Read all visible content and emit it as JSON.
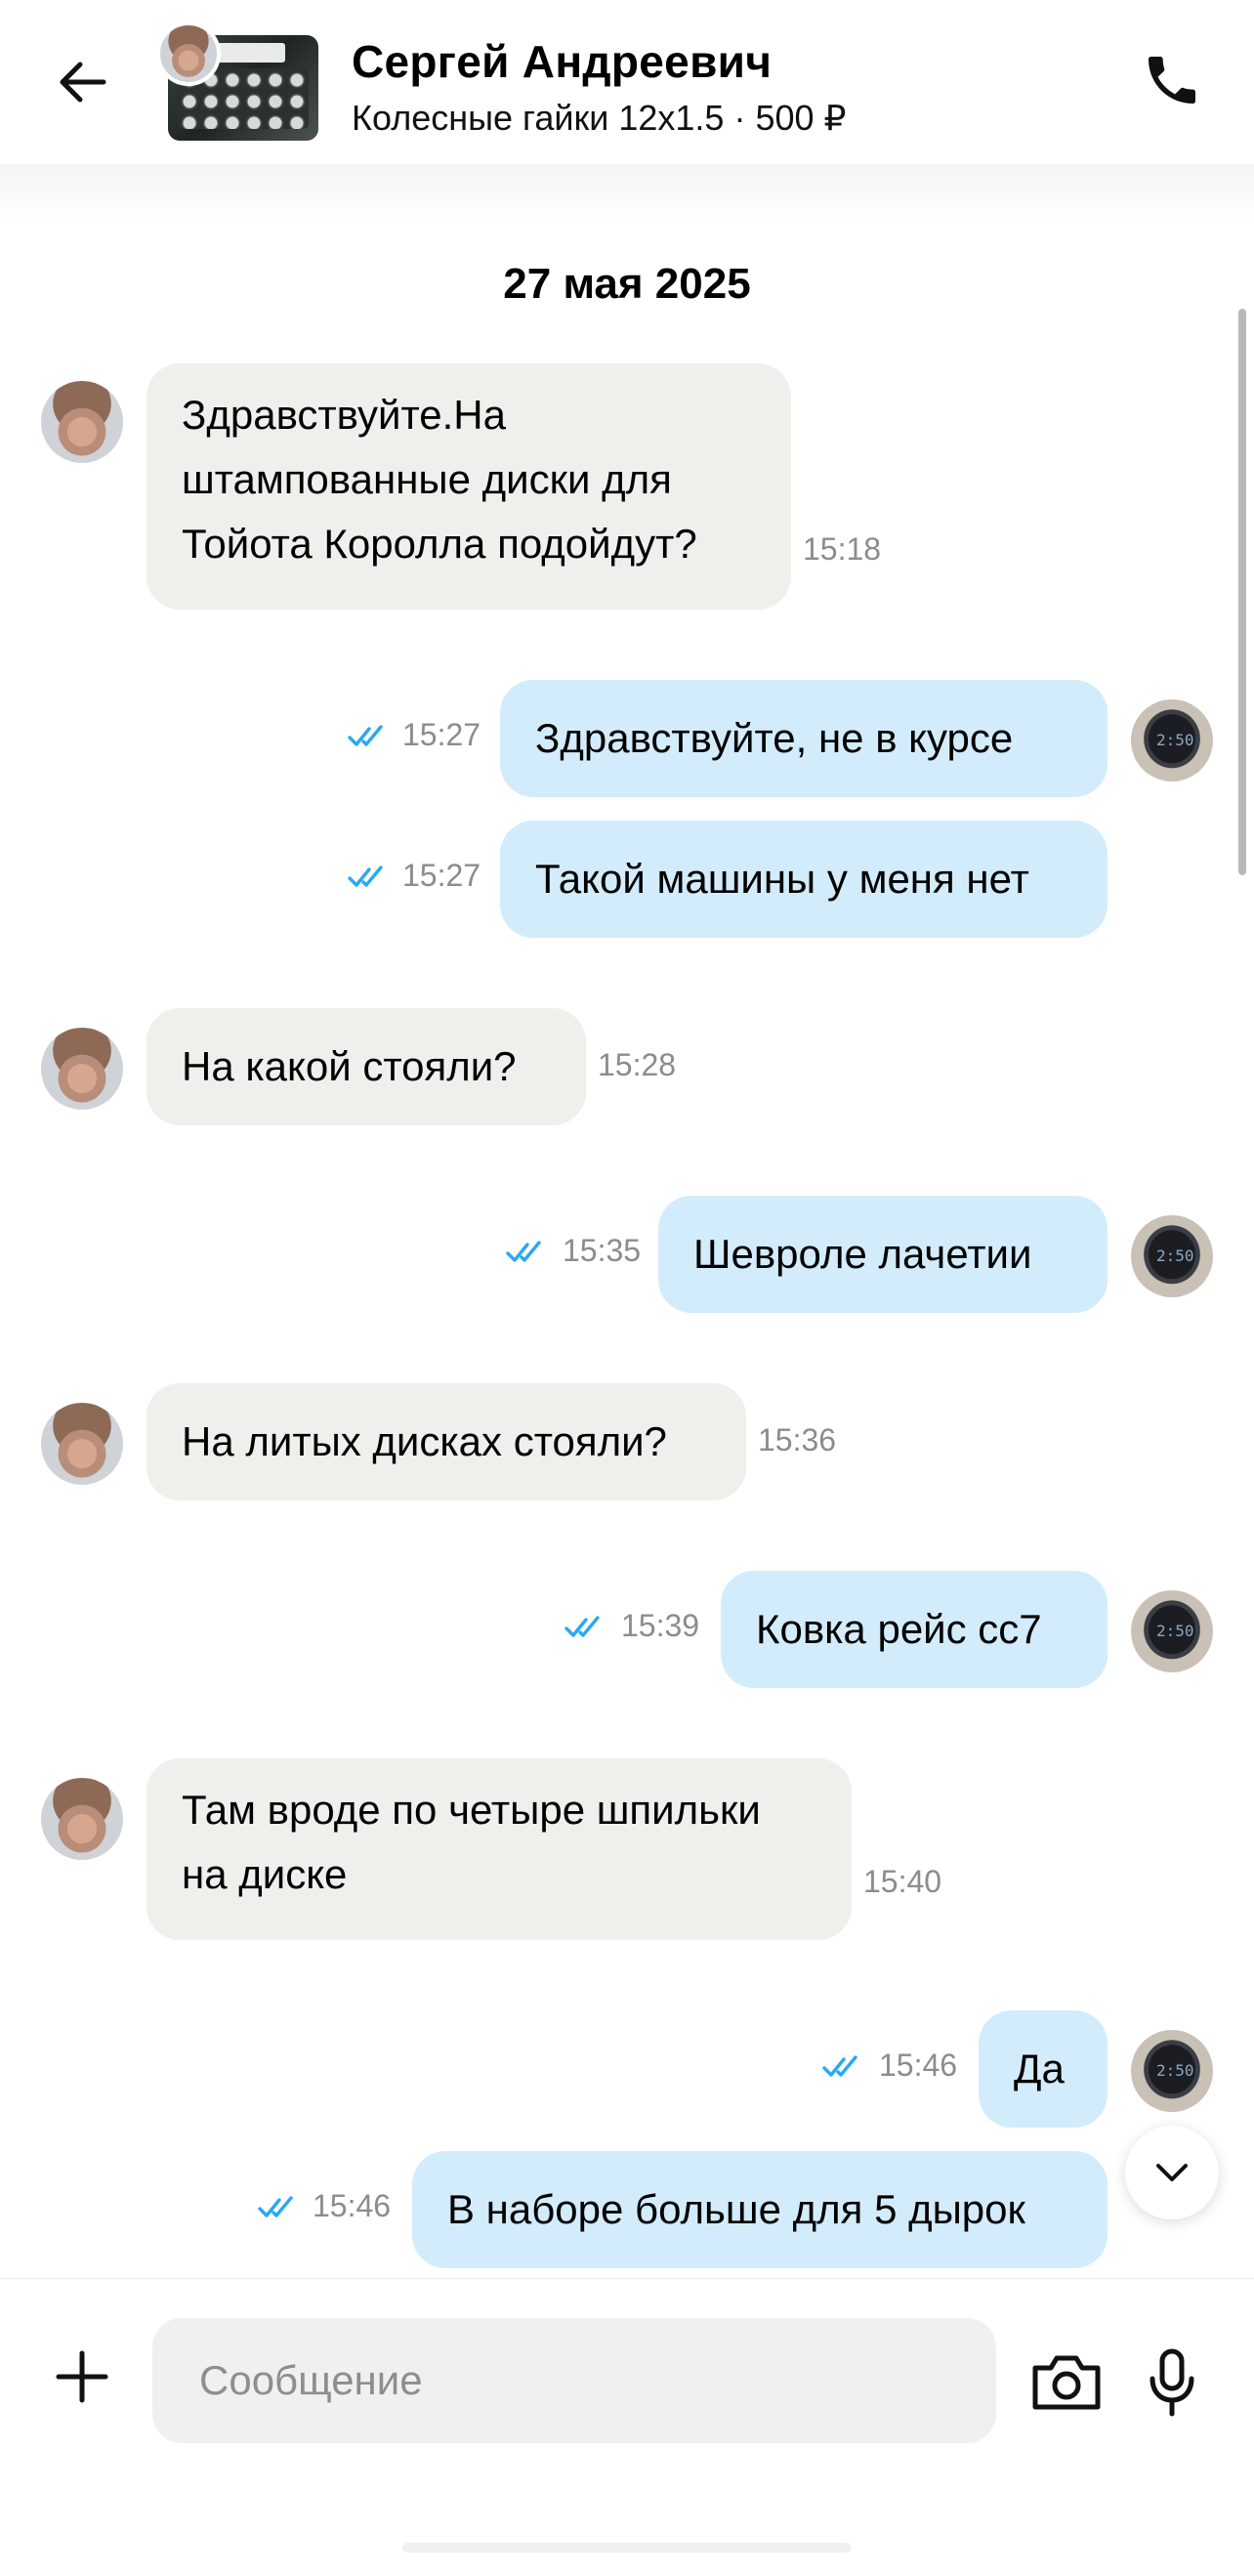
{
  "header": {
    "contact_name": "Сергей Андреевич",
    "listing_title": "Колесные гайки 12x1.5",
    "listing_price": "500 ₽",
    "separator": " · "
  },
  "chat": {
    "date": "27 мая 2025",
    "messages": [
      {
        "direction": "in",
        "text": "Здравствуйте.На штампованные диски для Тойота Королла подойдут?",
        "time": "15:18"
      },
      {
        "direction": "out",
        "text": "Здравствуйте, не в курсе",
        "time": "15:27",
        "status": "read"
      },
      {
        "direction": "out",
        "text": "Такой машины у меня нет",
        "time": "15:27",
        "status": "read"
      },
      {
        "direction": "in",
        "text": "На какой стояли?",
        "time": "15:28"
      },
      {
        "direction": "out",
        "text": "Шевроле лачетии",
        "time": "15:35",
        "status": "read"
      },
      {
        "direction": "in",
        "text": "На литых дисках стояли?",
        "time": "15:36"
      },
      {
        "direction": "out",
        "text": "Ковка рейс сс7",
        "time": "15:39",
        "status": "read"
      },
      {
        "direction": "in",
        "text": "Там вроде по четыре шпильки на диске",
        "time": "15:40"
      },
      {
        "direction": "out",
        "text": "Да",
        "time": "15:46",
        "status": "read"
      },
      {
        "direction": "out",
        "text": "В наборе больше для 5 дырок",
        "time": "15:46",
        "status": "read"
      }
    ]
  },
  "composer": {
    "placeholder": "Сообщение"
  },
  "colors": {
    "incoming_bubble": "#f1efeb",
    "outgoing_bubble": "#d3ecfb",
    "read_ticks": "#2aa8f2",
    "timestamp": "#8c8c8c"
  },
  "icons": {
    "back": "arrow-left-icon",
    "call": "phone-icon",
    "add": "plus-icon",
    "camera": "camera-icon",
    "mic": "microphone-icon",
    "scroll_down": "chevron-down-icon",
    "read_status": "double-check-icon"
  }
}
